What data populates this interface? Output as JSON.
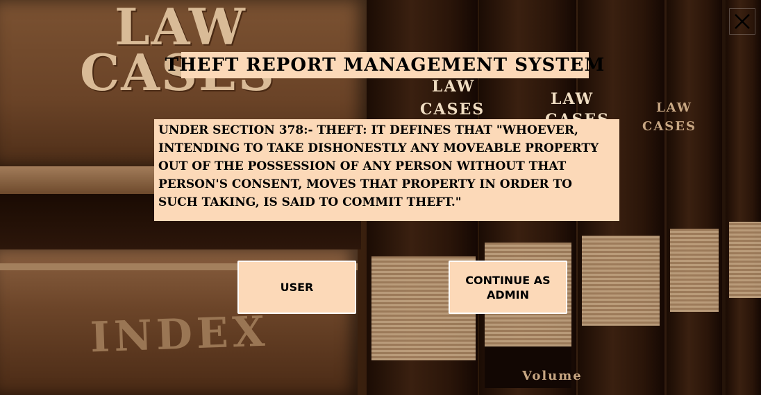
{
  "window": {
    "close_icon": "close-icon"
  },
  "header": {
    "title": "THEFT REPORT MANAGEMENT SYSTEM"
  },
  "main": {
    "definition": "Under section 378:- Theft: It defines that \"whoever, intending to take dishonestly any moveable property out of the possession of any person without that person's consent, moves that property in order to such taking, is said to commit theft.\""
  },
  "actions": {
    "user_label": "USER",
    "admin_label": "CONTINUE AS ADMIN"
  },
  "background": {
    "book_text_1": "LAW",
    "book_text_2": "CASES",
    "spine_1_line1": "LAW",
    "spine_1_line2": "CASES",
    "spine_2_line1": "LAW",
    "spine_2_line2": "CASES",
    "spine_3_line1": "LAW",
    "spine_3_line2": "CASES",
    "index_text": "INDEX",
    "volume_text": "Volume"
  },
  "colors": {
    "panel": "#fcd9b8",
    "text": "#000000",
    "button_border": "#ffffff"
  }
}
